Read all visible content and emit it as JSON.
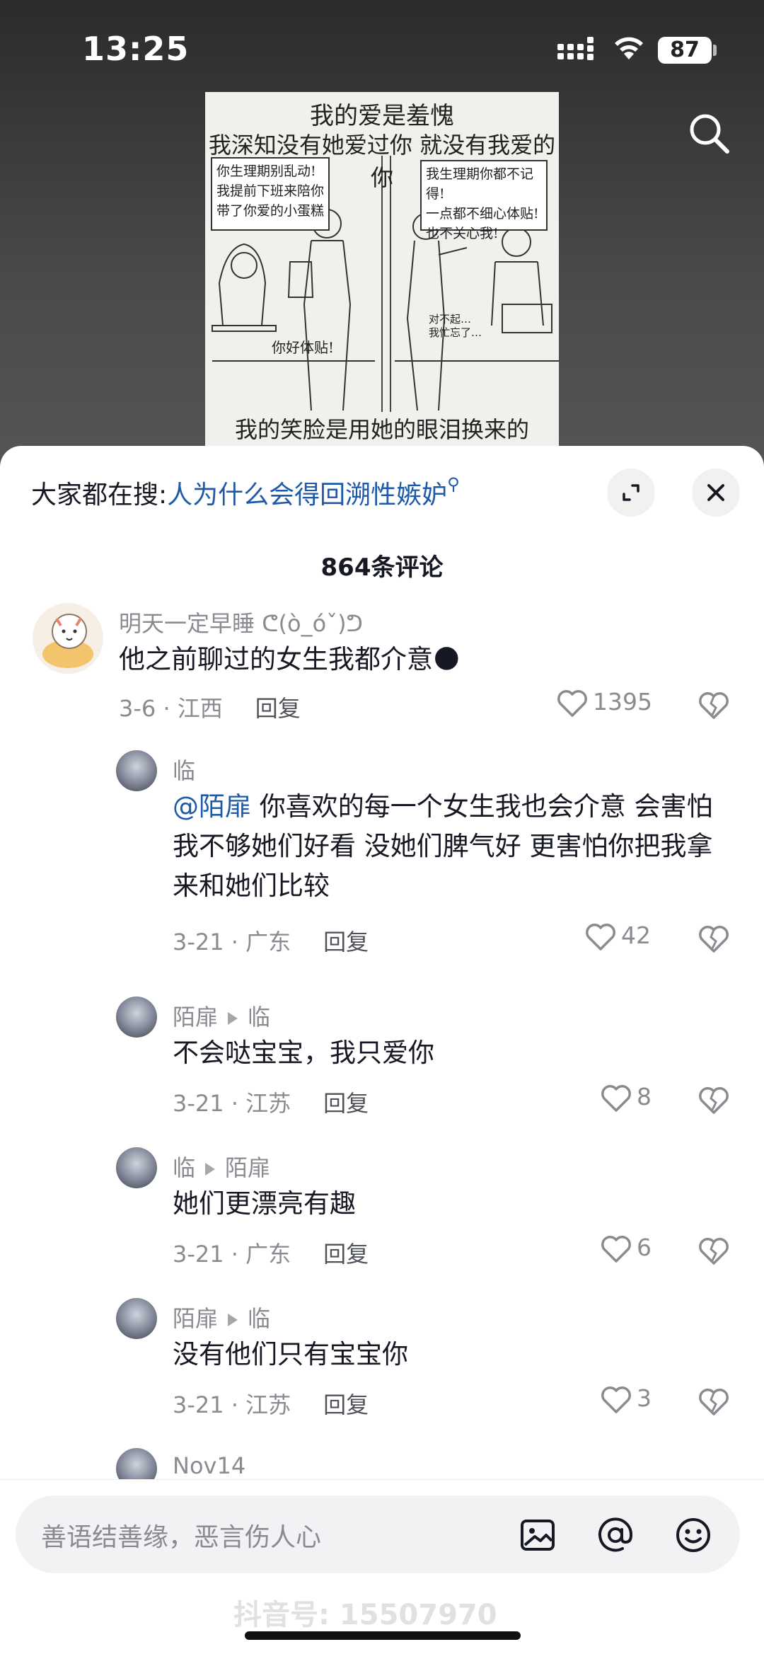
{
  "status": {
    "time": "13:25",
    "battery": "87"
  },
  "comic": {
    "title1": "我的爱是羞愧",
    "title2": "我深知没有她爱过你 就没有我爱的你",
    "bubble_left": "你生理期别乱动!\n我提前下班来陪你\n带了你爱的小蛋糕",
    "bubble_right": "我生理期你都不记得!\n一点都不细心体贴!\n也不关心我!",
    "small_left": "你好体贴!",
    "small_right": "对不起…\n我忙忘了…",
    "bottom": "我的笑脸是用她的眼泪换来的"
  },
  "hot_search": {
    "prefix": "大家都在搜:",
    "keyword": "人为什么会得回溯性嫉妒"
  },
  "comment_count": "864条评论",
  "comments": [
    {
      "user": "明天一定早睡 ᕦ(ò_óˇ)ᕤ",
      "text": "他之前聊过的女生我都介意",
      "emoji": "🌑",
      "date": "3-6 · 江西",
      "reply_label": "回复",
      "likes": "1395"
    },
    {
      "user": "临",
      "mention": "@陌扉",
      "text": " 你喜欢的每一个女生我也会介意 会害怕我不够她们好看 没她们脾气好 更害怕你把我拿来和她们比较",
      "date": "3-21 · 广东",
      "reply_label": "回复",
      "likes": "42"
    },
    {
      "user": "陌扉",
      "to": "临",
      "text": "不会哒宝宝，我只爱你",
      "date": "3-21 · 江苏",
      "reply_label": "回复",
      "likes": "8"
    },
    {
      "user": "临",
      "to": "陌扉",
      "text": "她们更漂亮有趣",
      "date": "3-21 · 广东",
      "reply_label": "回复",
      "likes": "6"
    },
    {
      "user": "陌扉",
      "to": "临",
      "text": "没有他们只有宝宝你",
      "date": "3-21 · 江苏",
      "reply_label": "回复",
      "likes": "3"
    },
    {
      "user": "Nov14"
    }
  ],
  "input": {
    "placeholder": "善语结善缘，恶言伤人心"
  },
  "watermark": "抖音号: 15507970",
  "icons": {
    "search": "search-icon",
    "expand": "expand-icon",
    "close": "close-icon",
    "like": "heart-icon",
    "dislike": "broken-heart-icon",
    "image": "image-icon",
    "at": "at-icon",
    "emoji": "emoji-icon"
  }
}
